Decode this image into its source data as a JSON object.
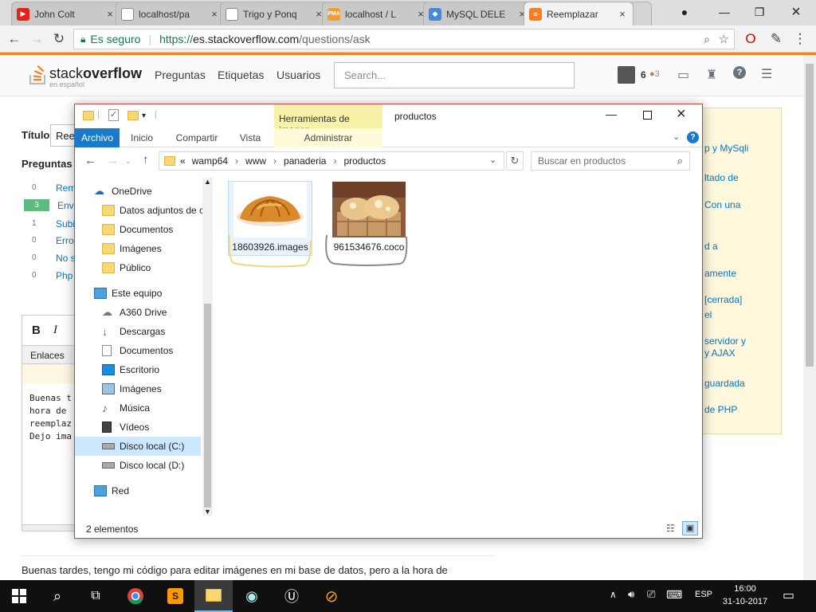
{
  "browser": {
    "tabs": [
      {
        "label": "John Colt",
        "favicon_color": "#e62117",
        "icon": "youtube-icon"
      },
      {
        "label": "localhost/pa",
        "favicon_color": "#ffffff",
        "icon": "page-icon"
      },
      {
        "label": "Trigo y Ponq",
        "favicon_color": "#ffffff",
        "icon": "page-icon"
      },
      {
        "label": "localhost / L",
        "favicon_color": "#f0a030",
        "icon": "phpmyadmin-icon"
      },
      {
        "label": "MySQL DELE",
        "favicon_color": "#4a88d8",
        "icon": "shield-icon"
      },
      {
        "label": "Reemplazar",
        "favicon_color": "#f48024",
        "icon": "stackoverflow-icon"
      }
    ],
    "secure_label": "Es seguro",
    "url_scheme": "https://",
    "url_host": "es.stackoverflow.com",
    "url_path": "/questions/ask"
  },
  "so": {
    "logo_a": "stack",
    "logo_b": "overflow",
    "logo_sub": "en español",
    "nav": [
      "Preguntas",
      "Etiquetas",
      "Usuarios"
    ],
    "search_placeholder": "Search...",
    "rep": "6",
    "badge_bronze": "●3",
    "title_label": "Título",
    "title_value": "Ree",
    "similar_label": "Preguntas",
    "similar": [
      {
        "votes": "0",
        "title": "Rem"
      },
      {
        "votes": "3",
        "title": "Env"
      },
      {
        "votes": "1",
        "title": "Subi"
      },
      {
        "votes": "0",
        "title": "Erro"
      },
      {
        "votes": "0",
        "title": "No s"
      },
      {
        "votes": "0",
        "title": "Php"
      }
    ],
    "editor_bold": "B",
    "editor_italic": "I",
    "editor_links": "Enlaces",
    "editor_lines": [
      "Buenas t",
      "hora de ",
      "reemplaz",
      "",
      "Dejo ima"
    ],
    "side_links": [
      "p y MySqli",
      "ltado de",
      "Con una",
      "d a",
      "amente",
      "[cerrada]",
      "el",
      "servidor y",
      "y AJAX",
      "guardada",
      "de PHP"
    ],
    "bottom_text": "Buenas tardes, tengo mi código para editar imágenes en mi base de datos, pero a la hora de"
  },
  "explorer": {
    "context_tab": "Herramientas de imagen",
    "window_title": "productos",
    "ribbon_tabs": [
      "Archivo",
      "Inicio",
      "Compartir",
      "Vista"
    ],
    "context_subtab": "Administrar",
    "breadcrumb": [
      "«",
      "wamp64",
      "www",
      "panaderia",
      "productos"
    ],
    "search_placeholder": "Buscar en productos",
    "nav": [
      {
        "label": "OneDrive",
        "icon": "onedrive-icon",
        "level": 0
      },
      {
        "label": "Datos adjuntos de c",
        "icon": "folder-icon",
        "level": 1
      },
      {
        "label": "Documentos",
        "icon": "folder-icon",
        "level": 1
      },
      {
        "label": "Imágenes",
        "icon": "folder-icon",
        "level": 1
      },
      {
        "label": "Público",
        "icon": "folder-icon",
        "level": 1
      },
      {
        "label": "Este equipo",
        "icon": "computer-icon",
        "level": 0
      },
      {
        "label": "A360 Drive",
        "icon": "cloud-drive-icon",
        "level": 1
      },
      {
        "label": "Descargas",
        "icon": "download-icon",
        "level": 1
      },
      {
        "label": "Documentos",
        "icon": "documents-icon",
        "level": 1
      },
      {
        "label": "Escritorio",
        "icon": "desktop-icon",
        "level": 1
      },
      {
        "label": "Imágenes",
        "icon": "pictures-icon",
        "level": 1
      },
      {
        "label": "Música",
        "icon": "music-icon",
        "level": 1
      },
      {
        "label": "Vídeos",
        "icon": "videos-icon",
        "level": 1
      },
      {
        "label": "Disco local (C:)",
        "icon": "drive-icon",
        "level": 1,
        "selected": true
      },
      {
        "label": "Disco local (D:)",
        "icon": "drive-icon",
        "level": 1
      },
      {
        "label": "Red",
        "icon": "network-icon",
        "level": 0
      }
    ],
    "files": [
      {
        "name": "18603926.images",
        "thumb": "croissant-thumbnail"
      },
      {
        "name": "961534676.coco",
        "thumb": "bread-rolls-thumbnail"
      }
    ],
    "status": "2 elementos"
  },
  "taskbar": {
    "language": "ESP",
    "time": "16:00",
    "date": "31-10-2017"
  }
}
